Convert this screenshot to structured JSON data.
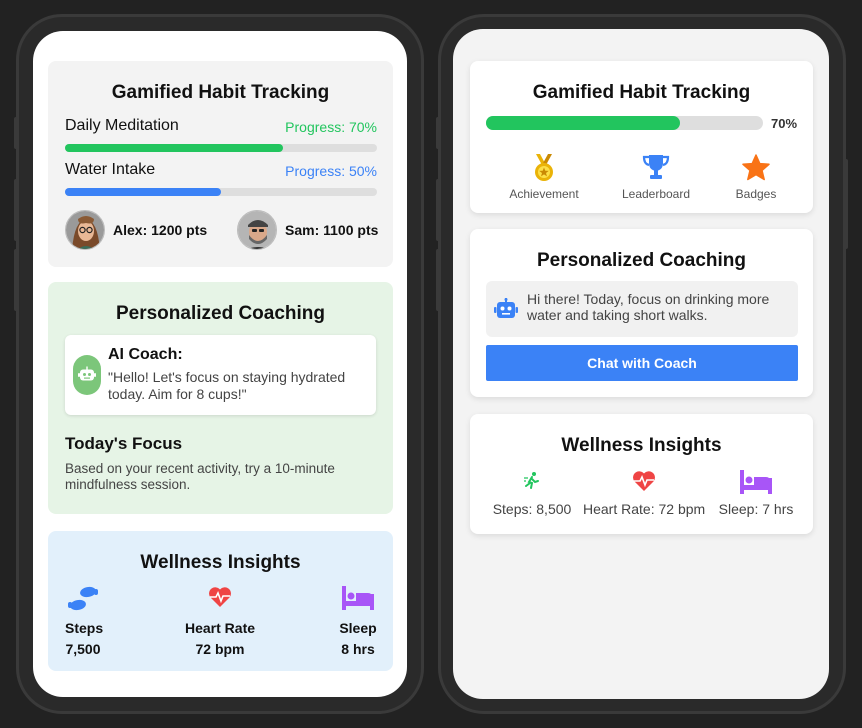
{
  "left": {
    "habit": {
      "title": "Gamified Habit Tracking",
      "items": [
        {
          "label": "Daily Meditation",
          "progress_text": "Progress: 70%",
          "progress": 70,
          "color": "#22c55e"
        },
        {
          "label": "Water Intake",
          "progress_text": "Progress: 50%",
          "progress": 50,
          "color": "#3b82f6"
        }
      ],
      "users": [
        {
          "name": "Alex: 1200 pts",
          "icon": "avatar-woman"
        },
        {
          "name": "Sam: 1100 pts",
          "icon": "avatar-man"
        }
      ]
    },
    "coach": {
      "title": "Personalized Coaching",
      "coach_name": "AI Coach:",
      "message": "\"Hello! Let's focus on staying hydrated today. Aim for 8 cups!\"",
      "focus_title": "Today's Focus",
      "focus_text": "Based on your recent activity, try a 10-minute mindfulness session."
    },
    "wellness": {
      "title": "Wellness Insights",
      "stats": [
        {
          "label": "Steps",
          "value": "7,500",
          "icon": "footprints-icon",
          "color": "#3b82f6"
        },
        {
          "label": "Heart Rate",
          "value": "72 bpm",
          "icon": "heartbeat-icon",
          "color": "#ef4444"
        },
        {
          "label": "Sleep",
          "value": "8 hrs",
          "icon": "bed-icon",
          "color": "#a855f7"
        }
      ]
    }
  },
  "right": {
    "habit": {
      "title": "Gamified Habit Tracking",
      "progress": 70,
      "progress_text": "70%",
      "color": "#22c55e",
      "rewards": [
        {
          "label": "Achievement",
          "icon": "medal-icon",
          "color": "#eab308"
        },
        {
          "label": "Leaderboard",
          "icon": "trophy-icon",
          "color": "#3b82f6"
        },
        {
          "label": "Badges",
          "icon": "star-icon",
          "color": "#f97316"
        }
      ]
    },
    "coach": {
      "title": "Personalized Coaching",
      "message": "Hi there! Today, focus on drinking more water and taking short walks.",
      "button": "Chat with Coach"
    },
    "wellness": {
      "title": "Wellness Insights",
      "stats": [
        {
          "label": "Steps: 8,500",
          "icon": "walking-icon",
          "color": "#22c55e"
        },
        {
          "label": "Heart Rate: 72 bpm",
          "icon": "heartbeat-icon",
          "color": "#ef4444"
        },
        {
          "label": "Sleep: 7 hrs",
          "icon": "bed-icon",
          "color": "#a855f7"
        }
      ]
    }
  }
}
